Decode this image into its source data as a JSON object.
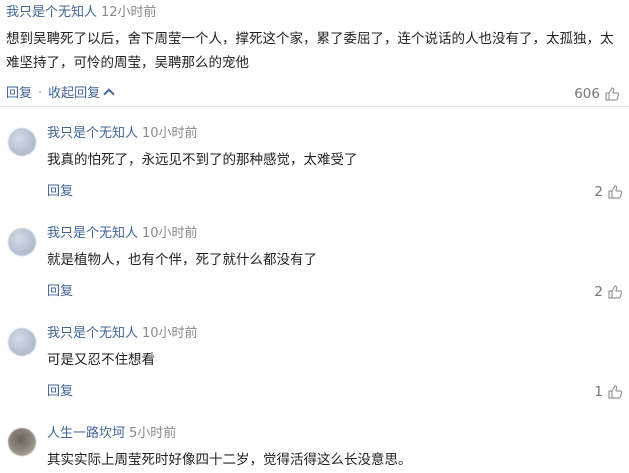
{
  "top_comment": {
    "username": "我只是个无知人",
    "time": "12小时前",
    "text": "想到吴聘死了以后，舍下周莹一个人，撑死这个家，累了委屈了，连个说话的人也没有了，太孤独，太难坚持了，可怜的周莹，吴聘那么的宠他",
    "reply_label": "回复",
    "separator": "·",
    "collapse_label": "收起回复",
    "likes": "606"
  },
  "replies": [
    {
      "username": "我只是个无知人",
      "time": "10小时前",
      "text": "我真的怕死了，永远见不到了的那种感觉，太难受了",
      "reply_label": "回复",
      "likes": "2"
    },
    {
      "username": "我只是个无知人",
      "time": "10小时前",
      "text": "就是植物人，也有个伴，死了就什么都没有了",
      "reply_label": "回复",
      "likes": "2"
    },
    {
      "username": "我只是个无知人",
      "time": "10小时前",
      "text": "可是又忍不住想看",
      "reply_label": "回复",
      "likes": "1"
    },
    {
      "username": "人生一路坎坷",
      "time": "5小时前",
      "text": "其实实际上周莹死时好像四十二岁，觉得活得这么长没意思。"
    }
  ],
  "colors": {
    "username": "#406599",
    "time": "#8a8a8a",
    "text": "#222222",
    "likes": "#777777"
  },
  "icons": {
    "like": "thumbs-up-icon",
    "collapse": "chevron-up-icon"
  }
}
